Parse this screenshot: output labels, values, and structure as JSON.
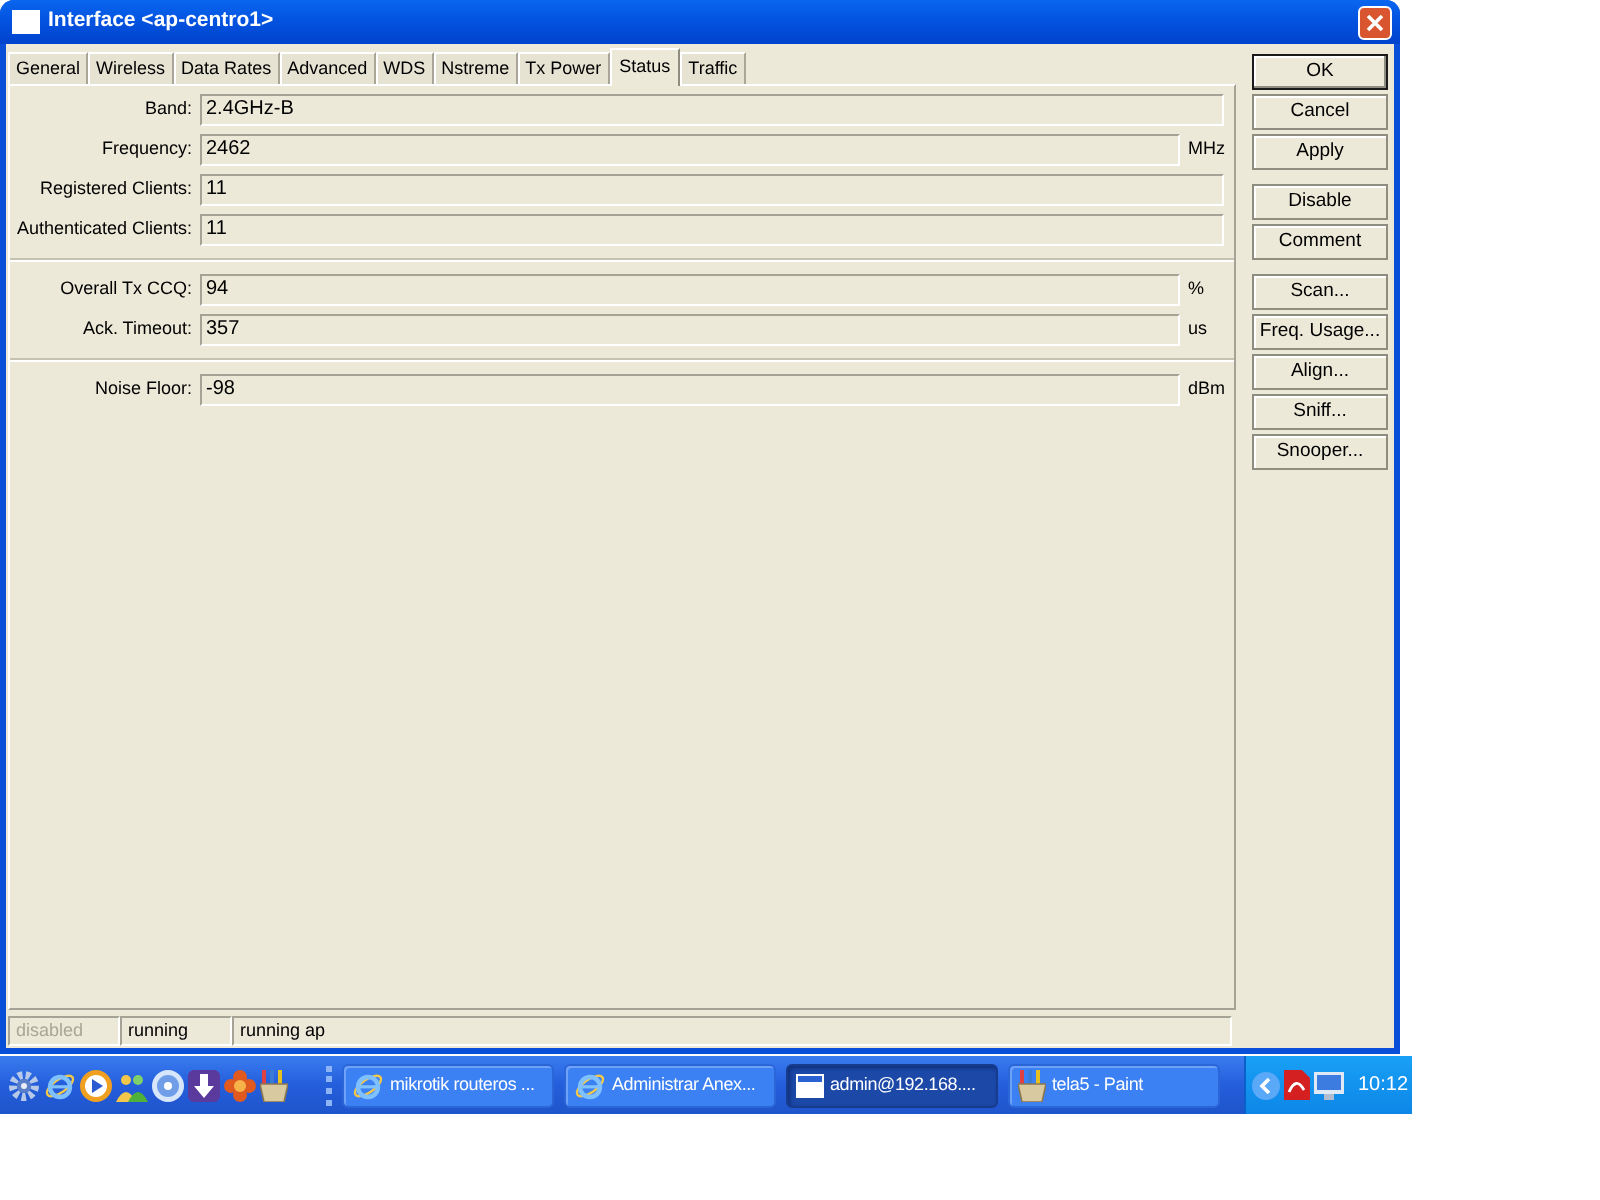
{
  "window": {
    "title": "Interface <ap-centro1>"
  },
  "tabs": [
    {
      "label": "General",
      "selected": false
    },
    {
      "label": "Wireless",
      "selected": false
    },
    {
      "label": "Data Rates",
      "selected": false
    },
    {
      "label": "Advanced",
      "selected": false
    },
    {
      "label": "WDS",
      "selected": false
    },
    {
      "label": "Nstreme",
      "selected": false
    },
    {
      "label": "Tx Power",
      "selected": false
    },
    {
      "label": "Status",
      "selected": true
    },
    {
      "label": "Traffic",
      "selected": false
    }
  ],
  "field_groups": [
    {
      "fields": [
        {
          "label": "Band:",
          "value": "2.4GHz-B"
        },
        {
          "label": "Frequency:",
          "value": "2462",
          "unit": "MHz"
        },
        {
          "label": "Registered Clients:",
          "value": "11"
        },
        {
          "label": "Authenticated Clients:",
          "value": "11"
        }
      ]
    },
    {
      "fields": [
        {
          "label": "Overall Tx CCQ:",
          "value": "94",
          "unit": "%"
        },
        {
          "label": "Ack. Timeout:",
          "value": "357",
          "unit": "us"
        }
      ]
    },
    {
      "fields": [
        {
          "label": "Noise Floor:",
          "value": "-98",
          "unit": "dBm"
        }
      ]
    }
  ],
  "button_groups": [
    {
      "buttons": [
        {
          "label": "OK",
          "default": true
        },
        {
          "label": "Cancel",
          "default": false
        },
        {
          "label": "Apply",
          "default": false
        }
      ]
    },
    {
      "buttons": [
        {
          "label": "Disable",
          "default": false
        },
        {
          "label": "Comment",
          "default": false
        }
      ]
    },
    {
      "buttons": [
        {
          "label": "Scan...",
          "default": false
        },
        {
          "label": "Freq. Usage...",
          "default": false
        },
        {
          "label": "Align...",
          "default": false
        },
        {
          "label": "Sniff...",
          "default": false
        },
        {
          "label": "Snooper...",
          "default": false
        }
      ]
    }
  ],
  "status_bar": [
    {
      "text": "disabled",
      "disabled": true
    },
    {
      "text": "running",
      "disabled": false
    },
    {
      "text": "running ap",
      "disabled": false
    }
  ],
  "taskbar": {
    "tasks": [
      {
        "label": "mikrotik routeros ...",
        "kind": "browser",
        "selected": false
      },
      {
        "label": "Administrar Anex...",
        "kind": "browser",
        "selected": false
      },
      {
        "label": "admin@192.168....",
        "kind": "terminal",
        "selected": true
      },
      {
        "label": "tela5 - Paint",
        "kind": "paint",
        "selected": false
      }
    ],
    "clock": "10:12"
  }
}
